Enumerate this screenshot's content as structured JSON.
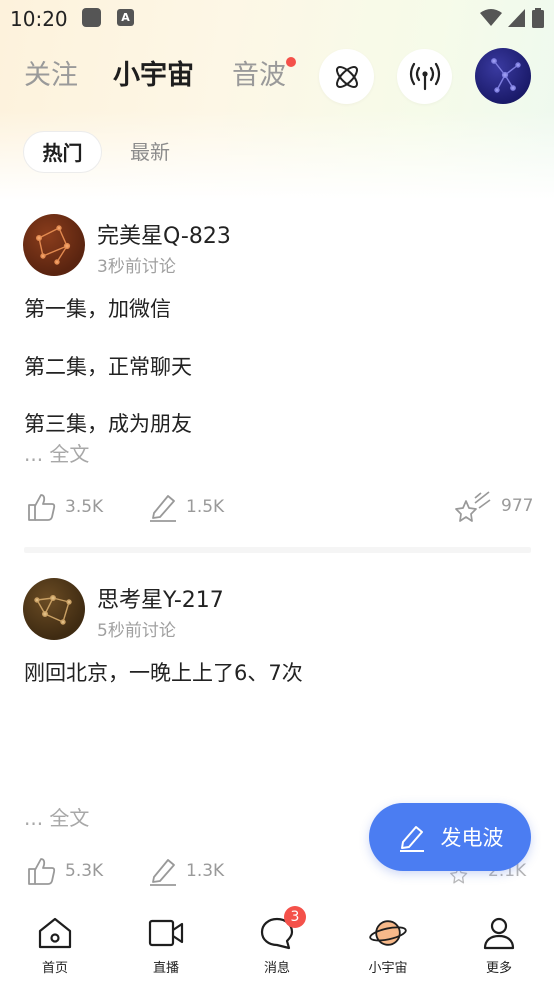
{
  "status_bar": {
    "time": "10:20",
    "app_icon_letter": "A"
  },
  "top_nav": {
    "tabs": [
      {
        "label": "关注",
        "active": false
      },
      {
        "label": "小宇宙",
        "active": true
      },
      {
        "label": "音波",
        "active": false,
        "has_dot": true
      }
    ]
  },
  "sub_tabs": [
    {
      "label": "热门",
      "active": true
    },
    {
      "label": "最新",
      "active": false
    }
  ],
  "posts": [
    {
      "author": "完美星Q-823",
      "time": "3秒前讨论",
      "lines": [
        "第一集，加微信",
        "第二集，正常聊天",
        "第三集，成为朋友"
      ],
      "read_more": "... 全文",
      "likes": "3.5K",
      "comments": "1.5K",
      "stars": "977"
    },
    {
      "author": "思考星Y-217",
      "time": "5秒前讨论",
      "lines": [
        "刚回北京，一晚上上了6、7次"
      ],
      "read_more": "... 全文",
      "likes": "5.3K",
      "comments": "1.3K",
      "stars": "2.1K"
    }
  ],
  "fab": {
    "label": "发电波"
  },
  "bottom_nav": {
    "items": [
      {
        "label": "首页",
        "icon": "home-icon"
      },
      {
        "label": "直播",
        "icon": "video-icon"
      },
      {
        "label": "消息",
        "icon": "chat-icon",
        "badge": "3"
      },
      {
        "label": "小宇宙",
        "icon": "planet-icon",
        "active": true
      },
      {
        "label": "更多",
        "icon": "person-icon"
      }
    ]
  },
  "colors": {
    "accent_blue": "#4b7df2",
    "badge_red": "#f4514a",
    "planet_orange": "#f7b98a"
  }
}
